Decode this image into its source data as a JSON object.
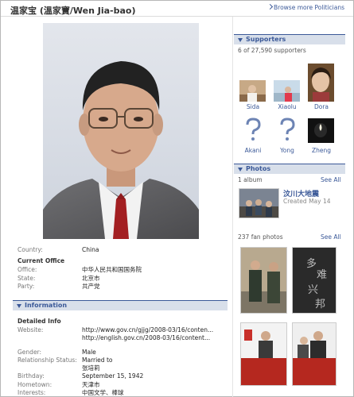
{
  "header": {
    "title": "温家宝 (溫家寶/Wen Jia-bao)",
    "browse_label": "Browse more Politicians"
  },
  "info_top": {
    "country_label": "Country:",
    "country_value": "China",
    "current_office_heading": "Current Office",
    "office_label": "Office:",
    "office_value": "中华人民共和国国务院",
    "state_label": "State:",
    "state_value": "北京市",
    "party_label": "Party:",
    "party_value": "共产党"
  },
  "information": {
    "header": "Information",
    "detailed_heading": "Detailed Info",
    "website_label": "Website:",
    "website_1": "http://www.gov.cn/gjjg/2008-03/16/conten...",
    "website_2": "http://english.gov.cn/2008-03/16/content...",
    "gender_label": "Gender:",
    "gender_value": "Male",
    "relationship_label": "Relationship Status:",
    "relationship_value": "Married to",
    "spouse": "张培莉",
    "birthday_label": "Birthday:",
    "birthday_value": "September 15, 1942",
    "hometown_label": "Hometown:",
    "hometown_value": "天津市",
    "interests_label": "Interests:",
    "interests_value": "中国文学、棒球"
  },
  "supporters": {
    "header": "Supporters",
    "count": "6 of 27,590 supporters",
    "people": [
      {
        "name": "Sida"
      },
      {
        "name": "Xiaolu"
      },
      {
        "name": "Dora"
      },
      {
        "name": "Akani"
      },
      {
        "name": "Yong"
      },
      {
        "name": "Zheng"
      }
    ]
  },
  "photos": {
    "header": "Photos",
    "album_count": "1 album",
    "see_all": "See All",
    "album_title": "汶川大地震",
    "album_created": "Created May 14",
    "fan_photos": "237 fan photos",
    "fan_see_all": "See All",
    "calligraphy": "多难兴邦"
  },
  "colors": {
    "link": "#3b5998",
    "section_header_bg": "#d8dfea"
  }
}
